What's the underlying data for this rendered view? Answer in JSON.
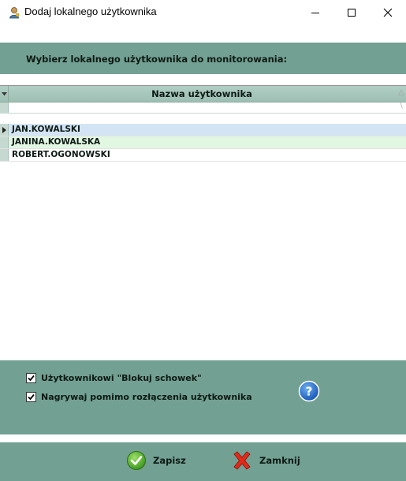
{
  "window": {
    "title": "Dodaj lokalnego użytkownika",
    "icons": {
      "app": "user-key-icon",
      "minimize": "minimize-icon",
      "maximize": "maximize-icon",
      "close": "close-icon"
    }
  },
  "header": {
    "label": "Wybierz lokalnego użytkownika do monitorowania:"
  },
  "grid": {
    "column_header": "Nazwa użytkownika",
    "rows": [
      "JAN.KOWALSKI",
      "JANINA.KOWALSKA",
      "ROBERT.OGONOWSKI"
    ],
    "selected_row": 0
  },
  "options": [
    {
      "label": "Użytkownikowi \"Blokuj schowek\"",
      "checked": true
    },
    {
      "label": "Nagrywaj pomimo rozłączenia użytkownika",
      "checked": true
    }
  ],
  "buttons": {
    "save": {
      "label": "Zapisz",
      "icon": "check-icon"
    },
    "close": {
      "label": "Zamknij",
      "icon": "x-icon"
    }
  },
  "colors": {
    "accent": "#72a093",
    "selected_row": "#d3e4f5",
    "alt_row": "#e2f7e2",
    "header_gradient": "#b2cfc4"
  }
}
